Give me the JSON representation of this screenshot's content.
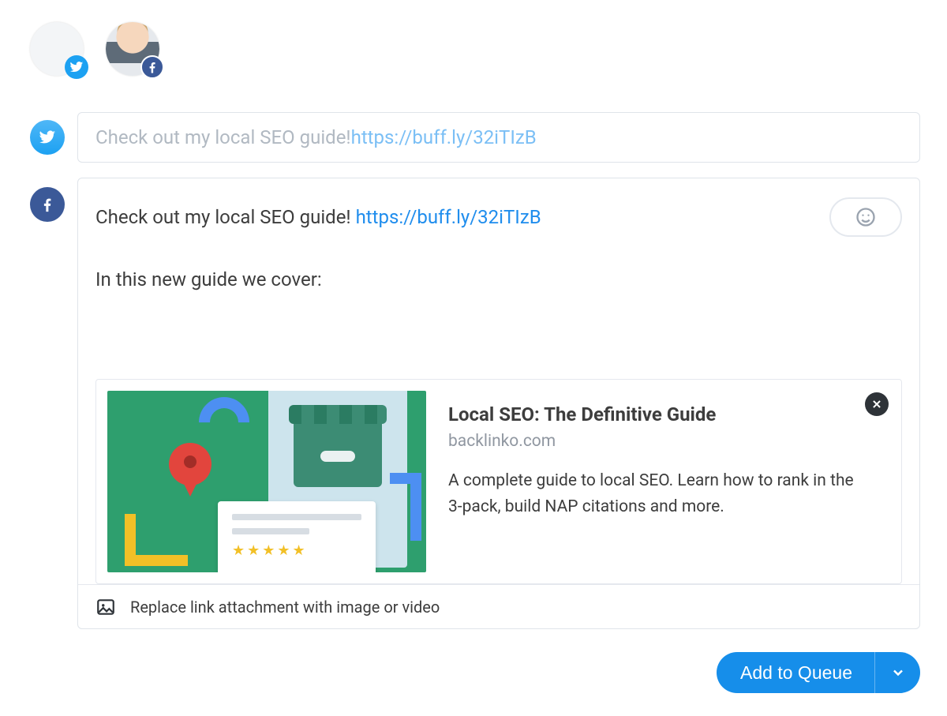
{
  "accounts": [
    {
      "network": "twitter",
      "avatar_style": "blank"
    },
    {
      "network": "facebook",
      "avatar_style": "face"
    }
  ],
  "twitter_composer": {
    "text": "Check out my local SEO guide! ",
    "link": "https://buff.ly/32iTIzB"
  },
  "facebook_composer": {
    "line1_prefix": "Check out my local SEO guide! ",
    "line1_link": "https://buff.ly/32iTIzB",
    "line2": "In this new guide we cover:",
    "link_preview": {
      "title": "Local SEO: The Definitive Guide",
      "domain": "backlinko.com",
      "description": "A complete guide to local SEO. Learn how to rank in the 3-pack, build NAP citations and more."
    },
    "replace_attachment": "Replace link attachment with image or video"
  },
  "actions": {
    "add_to_queue": "Add to Queue"
  },
  "icons": {
    "twitter": "twitter-icon",
    "facebook": "facebook-icon",
    "emoji": "emoji-icon",
    "image": "image-icon",
    "close": "close-icon",
    "chevron": "chevron-down-icon"
  }
}
